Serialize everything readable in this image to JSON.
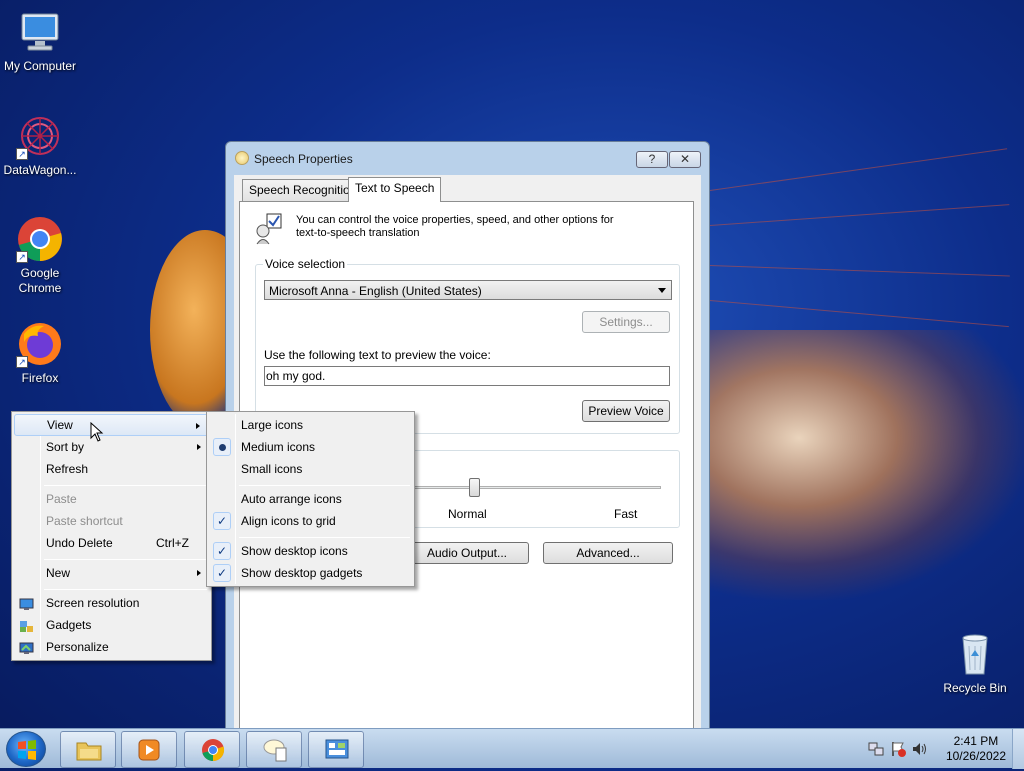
{
  "desktop": {
    "icons": [
      {
        "label": "My Computer"
      },
      {
        "label": "DataWagon..."
      },
      {
        "label": "Google Chrome"
      },
      {
        "label": "Firefox"
      },
      {
        "label": "Recycle Bin"
      }
    ]
  },
  "window": {
    "title": "Speech Properties",
    "help_button": "?",
    "close_button": "✕",
    "tabs": [
      {
        "label": "Speech Recognition",
        "selected": false
      },
      {
        "label": "Text to Speech",
        "selected": true
      }
    ],
    "intro_text": "You can control the voice properties, speed, and other options for text-to-speech translation",
    "voice_selection": {
      "group_label": "Voice selection",
      "selected_voice": "Microsoft Anna - English (United States)",
      "settings_button": "Settings...",
      "preview_label": "Use the following text to preview the voice:",
      "preview_text": "oh my god.",
      "preview_button": "Preview Voice"
    },
    "voice_speed": {
      "normal_label": "Normal",
      "fast_label": "Fast",
      "level": 0.5
    },
    "audio_output_button": "Audio Output...",
    "advanced_button": "Advanced..."
  },
  "context_menu": {
    "items": [
      {
        "label": "View",
        "submenu": true
      },
      {
        "label": "Sort by",
        "submenu": true
      },
      {
        "label": "Refresh"
      },
      {
        "label": "Paste",
        "disabled": true
      },
      {
        "label": "Paste shortcut",
        "disabled": true
      },
      {
        "label": "Undo Delete",
        "accelerator": "Ctrl+Z"
      },
      {
        "label": "New",
        "submenu": true
      },
      {
        "label": "Screen resolution",
        "icon": "display-icon"
      },
      {
        "label": "Gadgets",
        "icon": "gadgets-icon"
      },
      {
        "label": "Personalize",
        "icon": "personalize-icon"
      }
    ]
  },
  "view_submenu": {
    "items": [
      {
        "label": "Large icons"
      },
      {
        "label": "Medium icons",
        "selected": true
      },
      {
        "label": "Small icons"
      },
      {
        "label": "Auto arrange icons"
      },
      {
        "label": "Align icons to grid",
        "checked": true
      },
      {
        "label": "Show desktop icons",
        "checked": true
      },
      {
        "label": "Show desktop gadgets",
        "checked": true
      }
    ]
  },
  "taskbar": {
    "pinned": [
      "windows-explorer-icon",
      "media-player-icon",
      "chrome-icon",
      "speech-icon",
      "control-panel-icon"
    ],
    "clock": {
      "time": "2:41 PM",
      "date": "10/26/2022"
    }
  },
  "colors": {
    "accent": "#1e67c6",
    "desktop": "#0d2d8a"
  }
}
